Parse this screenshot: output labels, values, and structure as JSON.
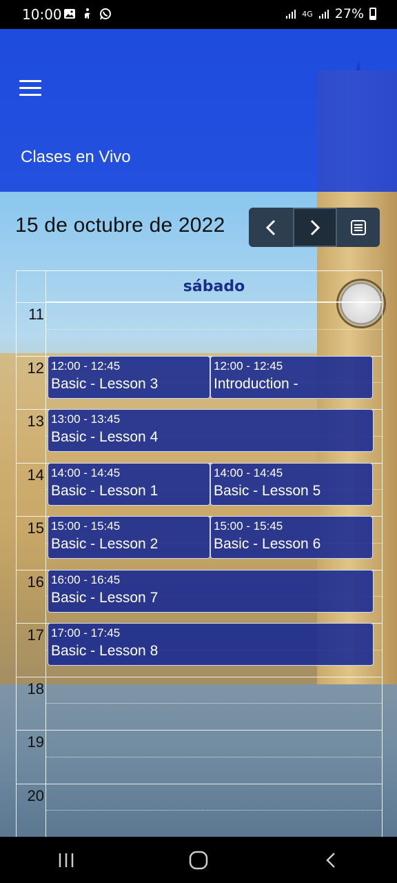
{
  "status_bar": {
    "time": "10:00",
    "network": "4G",
    "battery": "27%",
    "icons": [
      "gallery-icon",
      "accessibility-icon",
      "whatsapp-icon",
      "wifi-signal-icon",
      "cell-signal-icon",
      "battery-icon"
    ]
  },
  "header": {
    "menu_icon": "hamburger-menu-icon",
    "title": "Clases en Vivo",
    "background_color": "#1436d8"
  },
  "toolbar": {
    "date_title": "15 de octubre de 2022",
    "prev_icon": "chevron-left-icon",
    "next_icon": "chevron-right-icon",
    "list_icon": "list-view-icon",
    "button_color": "#2c3e50"
  },
  "calendar": {
    "day_label": "sábado",
    "hours": [
      "11",
      "12",
      "13",
      "14",
      "15",
      "16",
      "17",
      "18",
      "19",
      "20"
    ],
    "events": [
      {
        "time": "12:00 - 12:45",
        "title": "Basic - Lesson 3",
        "hour": 12,
        "column": 0,
        "span": 1
      },
      {
        "time": "12:00 - 12:45",
        "title": "Introduction -",
        "hour": 12,
        "column": 1,
        "span": 1
      },
      {
        "time": "13:00 - 13:45",
        "title": "Basic - Lesson 4",
        "hour": 13,
        "column": 0,
        "span": 2
      },
      {
        "time": "14:00 - 14:45",
        "title": "Basic - Lesson 1",
        "hour": 14,
        "column": 0,
        "span": 1
      },
      {
        "time": "14:00 - 14:45",
        "title": "Basic - Lesson 5",
        "hour": 14,
        "column": 1,
        "span": 1
      },
      {
        "time": "15:00 - 15:45",
        "title": "Basic - Lesson 2",
        "hour": 15,
        "column": 0,
        "span": 1
      },
      {
        "time": "15:00 - 15:45",
        "title": "Basic - Lesson 6",
        "hour": 15,
        "column": 1,
        "span": 1
      },
      {
        "time": "16:00 - 16:45",
        "title": "Basic - Lesson 7",
        "hour": 16,
        "column": 0,
        "span": 2
      },
      {
        "time": "17:00 - 17:45",
        "title": "Basic - Lesson 8",
        "hour": 17,
        "column": 0,
        "span": 2
      }
    ],
    "event_color": "#112594"
  },
  "nav_bar": {
    "recent_icon": "recent-apps-icon",
    "home_icon": "home-icon",
    "back_icon": "back-icon"
  }
}
